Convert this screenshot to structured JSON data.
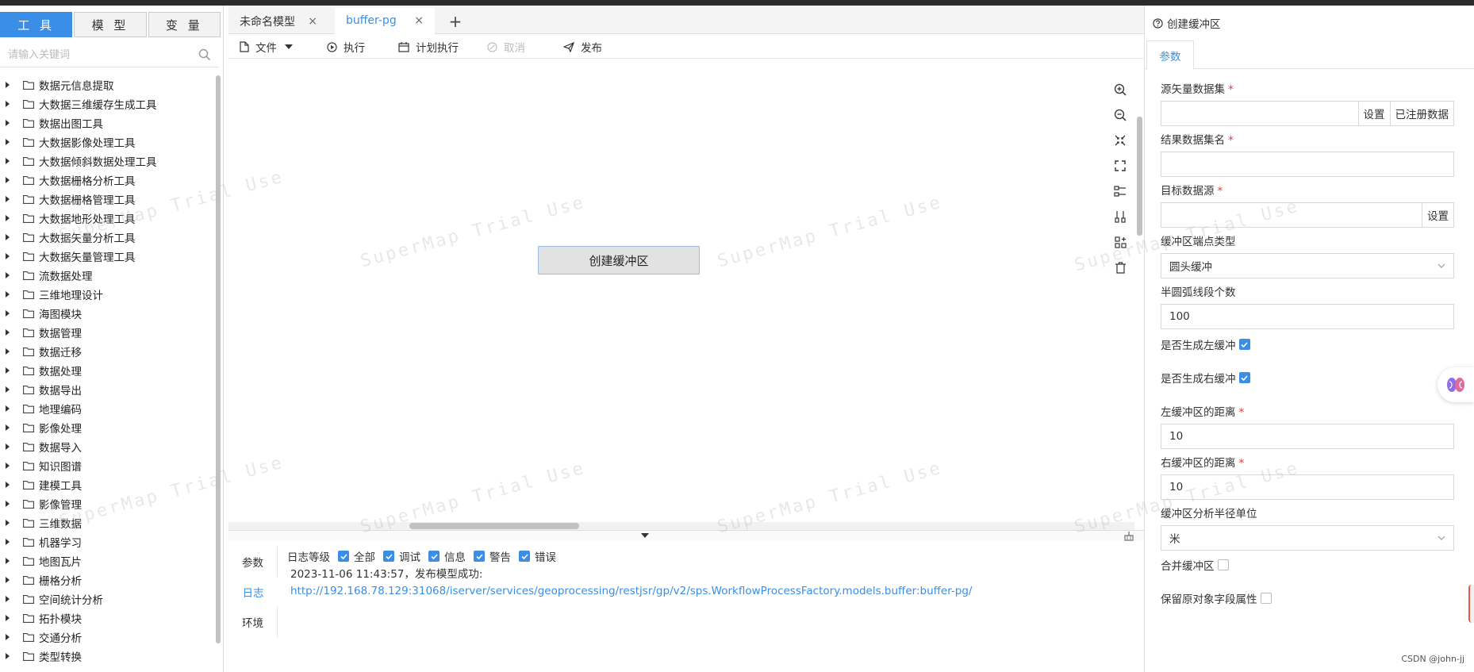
{
  "left_panel": {
    "tabs": [
      "工 具",
      "模 型",
      "变 量"
    ],
    "active_tab": 0,
    "search_placeholder": "请输入关键词",
    "tree_items": [
      "数据元信息提取",
      "大数据三维缓存生成工具",
      "数据出图工具",
      "大数据影像处理工具",
      "大数据倾斜数据处理工具",
      "大数据栅格分析工具",
      "大数据栅格管理工具",
      "大数据地形处理工具",
      "大数据矢量分析工具",
      "大数据矢量管理工具",
      "流数据处理",
      "三维地理设计",
      "海图模块",
      "数据管理",
      "数据迁移",
      "数据处理",
      "数据导出",
      "地理编码",
      "影像处理",
      "数据导入",
      "知识图谱",
      "建模工具",
      "影像管理",
      "三维数据",
      "机器学习",
      "地图瓦片",
      "栅格分析",
      "空间统计分析",
      "拓扑模块",
      "交通分析",
      "类型转换"
    ]
  },
  "editor_tabs": [
    {
      "label": "未命名模型",
      "close": "×"
    },
    {
      "label": "buffer-pg",
      "close": "×"
    }
  ],
  "add_tab": "+",
  "toolbar": {
    "file": "文件",
    "run": "执行",
    "schedule": "计划执行",
    "cancel": "取消",
    "publish": "发布"
  },
  "canvas": {
    "node_label": "创建缓冲区"
  },
  "log": {
    "side_tabs": [
      "参数",
      "日志",
      "环境"
    ],
    "active_side_tab": 1,
    "level_label": "日志等级",
    "levels": [
      "全部",
      "调试",
      "信息",
      "警告",
      "错误"
    ],
    "lines": [
      "2023-11-06 11:43:57，发布模型成功:",
      "http://192.168.78.129:31068/iserver/services/geoprocessing/restjsr/gp/v2/sps.WorkflowProcessFactory.models.buffer:buffer-pg/"
    ]
  },
  "right_panel": {
    "title": "创建缓冲区",
    "tab": "参数",
    "fields": {
      "source_label": "源矢量数据集",
      "set_button": "设置",
      "registered_button": "已注册数据",
      "result_name_label": "结果数据集名",
      "target_source_label": "目标数据源",
      "target_set_button": "设置",
      "end_type_label": "缓冲区端点类型",
      "end_type_value": "圆头缓冲",
      "arc_segments_label": "半圆弧线段个数",
      "arc_segments_value": "100",
      "left_buffer_label": "是否生成左缓冲",
      "right_buffer_label": "是否生成右缓冲",
      "left_distance_label": "左缓冲区的距离",
      "left_distance_value": "10",
      "right_distance_label": "右缓冲区的距离",
      "right_distance_value": "10",
      "unit_label": "缓冲区分析半径单位",
      "unit_value": "米",
      "merge_label": "合并缓冲区",
      "keep_fields_label": "保留原对象字段属性"
    }
  },
  "watermark": "SuperMap Trial Use",
  "credit": "CSDN @john-jj",
  "accent_color": "#3a8ee6"
}
